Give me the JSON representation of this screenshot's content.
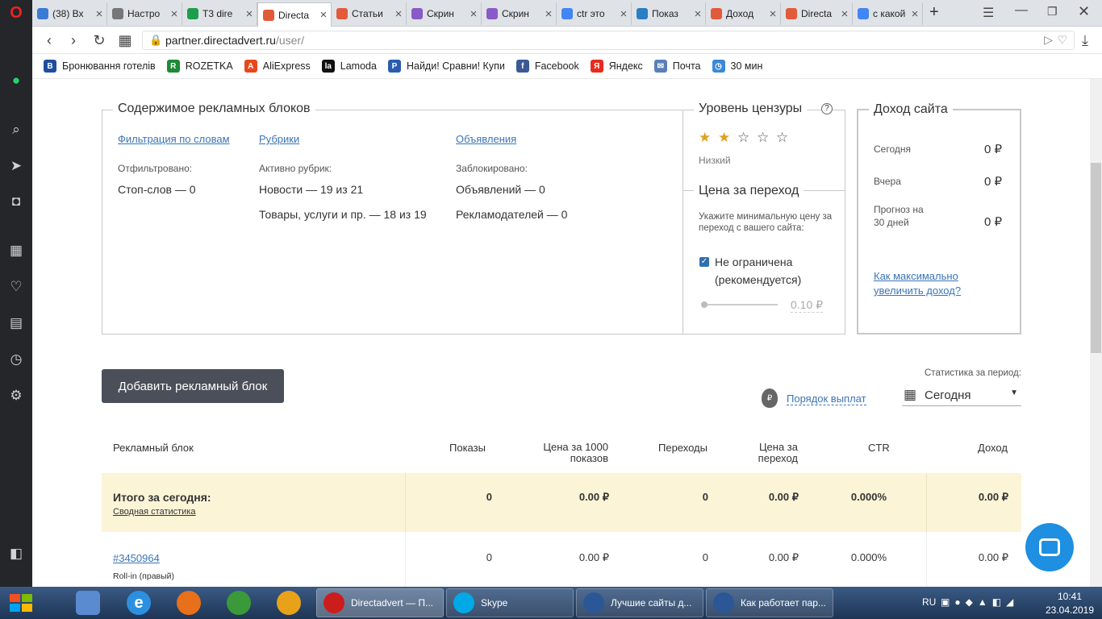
{
  "tabs": [
    {
      "label": "(38) Вх",
      "color": "#3a7bd5"
    },
    {
      "label": "Настро",
      "color": "#777777"
    },
    {
      "label": "Т3 dire",
      "color": "#1e9e4a"
    },
    {
      "label": "Directa",
      "color": "#e15b3a",
      "active": true
    },
    {
      "label": "Статьи",
      "color": "#e15b3a"
    },
    {
      "label": "Скрин",
      "color": "#8a5ac8"
    },
    {
      "label": "Скрин",
      "color": "#8a5ac8"
    },
    {
      "label": "ctr это",
      "color": "#4285f4"
    },
    {
      "label": "Показ",
      "color": "#2a7fc4"
    },
    {
      "label": "Доход",
      "color": "#e15b3a"
    },
    {
      "label": "Directa",
      "color": "#e15b3a"
    },
    {
      "label": "с какой",
      "color": "#4285f4"
    }
  ],
  "new_tab": "+",
  "address": {
    "host": "partner.directadvert.ru",
    "path": "/user/"
  },
  "bookmarks": [
    {
      "label": "Бронювання готелів",
      "icon": "B",
      "color": "#1f4e9c"
    },
    {
      "label": "ROZETKA",
      "icon": "R",
      "color": "#1f8a36"
    },
    {
      "label": "AliExpress",
      "icon": "A",
      "color": "#e8471c"
    },
    {
      "label": "Lamoda",
      "icon": "la",
      "color": "#111111"
    },
    {
      "label": "Найди! Сравни! Купи",
      "icon": "P",
      "color": "#2a5db0"
    },
    {
      "label": "Facebook",
      "icon": "f",
      "color": "#3b5998"
    },
    {
      "label": "Яндекс",
      "icon": "Я",
      "color": "#e62c1e"
    },
    {
      "label": "Почта",
      "icon": "✉",
      "color": "#5a7fb8"
    },
    {
      "label": "30 мин",
      "icon": "◷",
      "color": "#3a8ad8"
    }
  ],
  "content_blocks": {
    "title": "Содержимое рекламных блоков",
    "filter_link": "Фильтрация по словам",
    "rubrics_link": "Рубрики",
    "ads_link": "Объявления",
    "filtered_label": "Отфильтровано:",
    "stopwords": "Стоп-слов — 0",
    "active_rubrics_label": "Активно рубрик:",
    "news": "Новости — 19 из 21",
    "goods": "Товары, услуги и пр. — 18 из 19",
    "blocked_label": "Заблокировано:",
    "ads_blocked": "Объявлений — 0",
    "advertisers_blocked": "Рекламодателей — 0"
  },
  "censorship": {
    "title": "Уровень цензуры",
    "help": "?",
    "rating": 2,
    "max": 5,
    "level": "Низкий"
  },
  "cpc": {
    "title": "Цена за переход",
    "hint": "Укажите минимальную цену за переход с вашего сайта:",
    "checkbox_label": "Не ограничена (рекомендуется)",
    "checked": true,
    "value": "0.10 ₽"
  },
  "income": {
    "title": "Доход сайта",
    "today_label": "Сегодня",
    "today": "0 ₽",
    "yesterday_label": "Вчера",
    "yesterday": "0 ₽",
    "forecast_label": "Прогноз на 30 дней",
    "forecast": "0 ₽",
    "link": "Как максимально увеличить доход?"
  },
  "add_button": "Добавить рекламный блок",
  "payout_link": "Порядок выплат",
  "period": {
    "label": "Статистика за период:",
    "value": "Сегодня"
  },
  "table": {
    "headers": [
      "Рекламный блок",
      "Показы",
      "Цена за 1000 показов",
      "Переходы",
      "Цена за переход",
      "CTR",
      "Доход"
    ],
    "total": {
      "title": "Итого за сегодня:",
      "link": "Сводная статистика",
      "values": [
        "0",
        "0.00 ₽",
        "0",
        "0.00 ₽",
        "0.000%",
        "0.00 ₽"
      ]
    },
    "rows": [
      {
        "id": "#3450964",
        "type": "Roll-in (правый)",
        "values": [
          "0",
          "0.00 ₽",
          "0",
          "0.00 ₽",
          "0.000%",
          "0.00 ₽"
        ]
      }
    ]
  },
  "taskbar": {
    "items": [
      {
        "label": "Directadvert — П...",
        "color": "#cc1d1d"
      },
      {
        "label": "Skype",
        "color": "#00a8e6"
      },
      {
        "label": "Лучшие сайты д...",
        "color": "#2b5797"
      },
      {
        "label": "Как работает пар...",
        "color": "#2b5797"
      }
    ],
    "lang": "RU",
    "time": "10:41",
    "date": "23.04.2019"
  }
}
